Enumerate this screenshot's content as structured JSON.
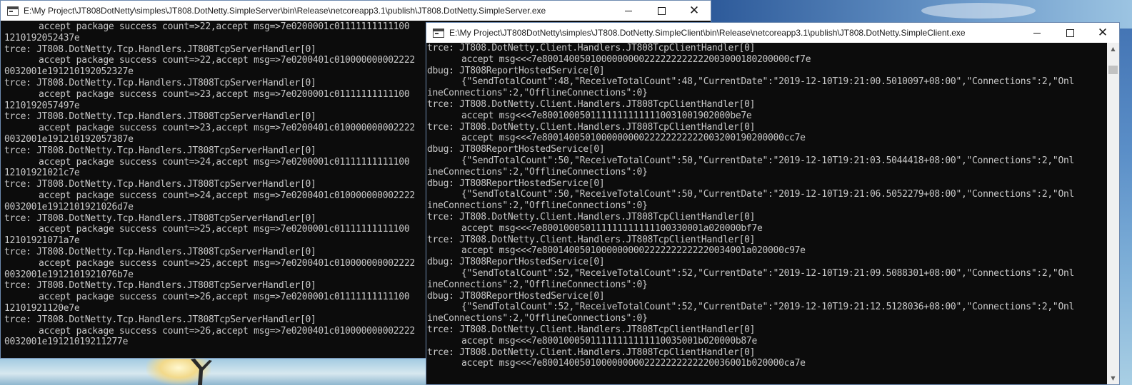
{
  "server": {
    "title": "E:\\My Project\\JT808DotNetty\\simples\\JT808.DotNetty.SimpleServer\\bin\\Release\\netcoreapp3.1\\publish\\JT808.DotNetty.SimpleServer.exe",
    "lines": [
      {
        "t": "accept package success count=>22,accept msg=>7e0200001c01111111111100",
        "indent": true
      },
      {
        "t": "1210192052437e",
        "indent": false
      },
      {
        "t": "trce: JT808.DotNetty.Tcp.Handlers.JT808TcpServerHandler[0]",
        "indent": false
      },
      {
        "t": "accept package success count=>22,accept msg=>7e0200401c010000000002222",
        "indent": true
      },
      {
        "t": "0032001e191210192052327e",
        "indent": false
      },
      {
        "t": "trce: JT808.DotNetty.Tcp.Handlers.JT808TcpServerHandler[0]",
        "indent": false
      },
      {
        "t": "accept package success count=>23,accept msg=>7e0200001c01111111111100",
        "indent": true
      },
      {
        "t": "1210192057497e",
        "indent": false
      },
      {
        "t": "trce: JT808.DotNetty.Tcp.Handlers.JT808TcpServerHandler[0]",
        "indent": false
      },
      {
        "t": "accept package success count=>23,accept msg=>7e0200401c010000000002222",
        "indent": true
      },
      {
        "t": "0032001e191210192057387e",
        "indent": false
      },
      {
        "t": "trce: JT808.DotNetty.Tcp.Handlers.JT808TcpServerHandler[0]",
        "indent": false
      },
      {
        "t": "accept package success count=>24,accept msg=>7e0200001c01111111111100",
        "indent": true
      },
      {
        "t": "12101921021c7e",
        "indent": false
      },
      {
        "t": "trce: JT808.DotNetty.Tcp.Handlers.JT808TcpServerHandler[0]",
        "indent": false
      },
      {
        "t": "accept package success count=>24,accept msg=>7e0200401c010000000002222",
        "indent": true
      },
      {
        "t": "0032001e1912101921026d7e",
        "indent": false
      },
      {
        "t": "trce: JT808.DotNetty.Tcp.Handlers.JT808TcpServerHandler[0]",
        "indent": false
      },
      {
        "t": "accept package success count=>25,accept msg=>7e0200001c01111111111100",
        "indent": true
      },
      {
        "t": "12101921071a7e",
        "indent": false
      },
      {
        "t": "trce: JT808.DotNetty.Tcp.Handlers.JT808TcpServerHandler[0]",
        "indent": false
      },
      {
        "t": "accept package success count=>25,accept msg=>7e0200401c010000000002222",
        "indent": true
      },
      {
        "t": "0032001e1912101921076b7e",
        "indent": false
      },
      {
        "t": "trce: JT808.DotNetty.Tcp.Handlers.JT808TcpServerHandler[0]",
        "indent": false
      },
      {
        "t": "accept package success count=>26,accept msg=>7e0200001c01111111111100",
        "indent": true
      },
      {
        "t": "12101921120e7e",
        "indent": false
      },
      {
        "t": "trce: JT808.DotNetty.Tcp.Handlers.JT808TcpServerHandler[0]",
        "indent": false
      },
      {
        "t": "accept package success count=>26,accept msg=>7e0200401c010000000002222",
        "indent": true
      },
      {
        "t": "0032001e19121019211277e",
        "indent": false
      }
    ]
  },
  "client": {
    "title": "E:\\My Project\\JT808DotNetty\\simples\\JT808.DotNetty.SimpleClient\\bin\\Release\\netcoreapp3.1\\publish\\JT808.DotNetty.SimpleClient.exe",
    "lines": [
      {
        "t": "trce: JT808.DotNetty.Client.Handlers.JT808TcpClientHandler[0]",
        "indent": false
      },
      {
        "t": "accept msg<<<7e8001400501000000000222222222222003000180200000cf7e",
        "indent": true
      },
      {
        "t": "dbug: JT808ReportHostedService[0]",
        "indent": false
      },
      {
        "t": "{\"SendTotalCount\":48,\"ReceiveTotalCount\":48,\"CurrentDate\":\"2019-12-10T19:21:00.5010097+08:00\",\"Connections\":2,\"Onl",
        "indent": true
      },
      {
        "t": "ineConnections\":2,\"OfflineConnections\":0}",
        "indent": false
      },
      {
        "t": "trce: JT808.DotNetty.Client.Handlers.JT808TcpClientHandler[0]",
        "indent": false
      },
      {
        "t": "accept msg<<<7e80010005011111111111110031001902000be7e",
        "indent": true
      },
      {
        "t": "trce: JT808.DotNetty.Client.Handlers.JT808TcpClientHandler[0]",
        "indent": false
      },
      {
        "t": "accept msg<<<7e800140050100000000022222222222003200190200000cc7e",
        "indent": true
      },
      {
        "t": "dbug: JT808ReportHostedService[0]",
        "indent": false
      },
      {
        "t": "{\"SendTotalCount\":50,\"ReceiveTotalCount\":50,\"CurrentDate\":\"2019-12-10T19:21:03.5044418+08:00\",\"Connections\":2,\"Onl",
        "indent": true
      },
      {
        "t": "ineConnections\":2,\"OfflineConnections\":0}",
        "indent": false
      },
      {
        "t": "dbug: JT808ReportHostedService[0]",
        "indent": false
      },
      {
        "t": "{\"SendTotalCount\":50,\"ReceiveTotalCount\":50,\"CurrentDate\":\"2019-12-10T19:21:06.5052279+08:00\",\"Connections\":2,\"Onl",
        "indent": true
      },
      {
        "t": "ineConnections\":2,\"OfflineConnections\":0}",
        "indent": false
      },
      {
        "t": "trce: JT808.DotNetty.Client.Handlers.JT808TcpClientHandler[0]",
        "indent": false
      },
      {
        "t": "accept msg<<<7e800100050111111111111100330001a020000bf7e",
        "indent": true
      },
      {
        "t": "trce: JT808.DotNetty.Client.Handlers.JT808TcpClientHandler[0]",
        "indent": false
      },
      {
        "t": "accept msg<<<7e80014005010000000002222222222220034001a020000c97e",
        "indent": true
      },
      {
        "t": "dbug: JT808ReportHostedService[0]",
        "indent": false
      },
      {
        "t": "{\"SendTotalCount\":52,\"ReceiveTotalCount\":52,\"CurrentDate\":\"2019-12-10T19:21:09.5088301+08:00\",\"Connections\":2,\"Onl",
        "indent": true
      },
      {
        "t": "ineConnections\":2,\"OfflineConnections\":0}",
        "indent": false
      },
      {
        "t": "dbug: JT808ReportHostedService[0]",
        "indent": false
      },
      {
        "t": "{\"SendTotalCount\":52,\"ReceiveTotalCount\":52,\"CurrentDate\":\"2019-12-10T19:21:12.5128036+08:00\",\"Connections\":2,\"Onl",
        "indent": true
      },
      {
        "t": "ineConnections\":2,\"OfflineConnections\":0}",
        "indent": false
      },
      {
        "t": "trce: JT808.DotNetty.Client.Handlers.JT808TcpClientHandler[0]",
        "indent": false
      },
      {
        "t": "accept msg<<<7e80010005011111111111110035001b020000b87e",
        "indent": true
      },
      {
        "t": "trce: JT808.DotNetty.Client.Handlers.JT808TcpClientHandler[0]",
        "indent": false
      },
      {
        "t": "accept msg<<<7e80014005010000000002222222222220036001b020000ca7e",
        "indent": true
      }
    ]
  },
  "window_controls": {
    "minimize": "minimize",
    "maximize": "maximize",
    "close": "✕"
  },
  "scrollbar": {
    "up": "▲",
    "down": "▼"
  },
  "colors": {
    "console_bg": "#0c0c0c",
    "console_text": "#c8c8c8",
    "titlebar_bg": "#ffffff"
  }
}
